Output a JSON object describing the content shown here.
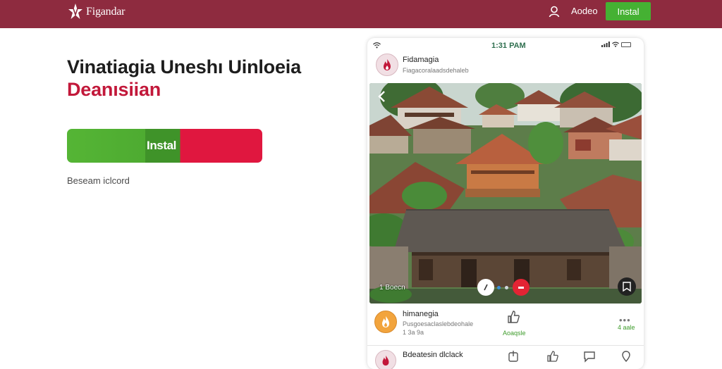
{
  "header": {
    "brand_name": "Figandar",
    "user_link": "Aodeo",
    "install_label": "Instal",
    "color": "#8e2b3f"
  },
  "hero": {
    "title": "Vinatiagia Uneshı Uinloeia",
    "subtitle": "Deanısiian",
    "install_label": "Instal",
    "secondary_link": "Beseam iclcord",
    "accent_green": "#4eab31",
    "accent_red": "#e0173f"
  },
  "phone": {
    "status_time": "1:31 PAM",
    "post": {
      "name": "Fidamagia",
      "handle": "Fiagacoralaadsdehaleb"
    },
    "photo": {
      "caption": "1 Boecn"
    },
    "feed_item": {
      "name": "himanegia",
      "meta_line_1": "Pusgoesaclaslebdeohale",
      "meta_line_2": "1 3a 9a",
      "like_label": "Aoaqsle",
      "more_label": "4 aale"
    },
    "bottom_item": {
      "name": "Bdeatesin dlclack"
    }
  }
}
